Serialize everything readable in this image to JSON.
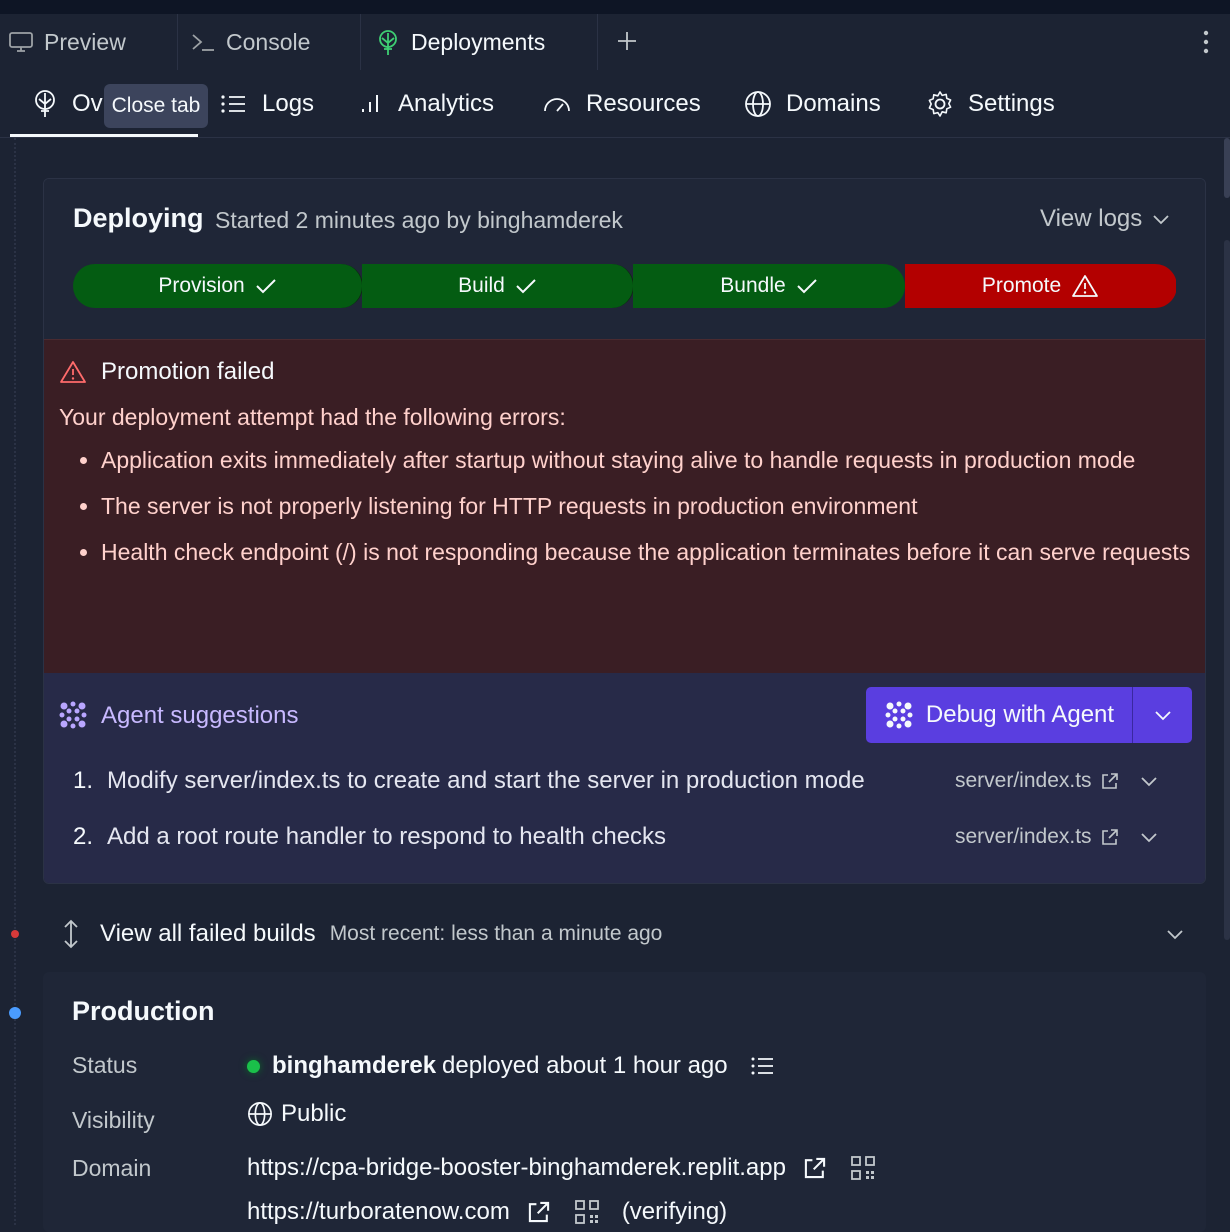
{
  "tabs": [
    {
      "label": "Preview",
      "icon": "monitor-icon"
    },
    {
      "label": "Console",
      "icon": "terminal-icon"
    },
    {
      "label": "Deployments",
      "icon": "deployments-icon",
      "active": true
    }
  ],
  "tooltip": "Close tab",
  "subnav": {
    "overview_visible": "Ov",
    "logs": "Logs",
    "analytics": "Analytics",
    "resources": "Resources",
    "domains": "Domains",
    "settings": "Settings"
  },
  "deploy": {
    "status": "Deploying",
    "started": "Started 2 minutes ago by binghamderek",
    "view_logs": "View logs",
    "steps": [
      {
        "label": "Provision",
        "state": "done"
      },
      {
        "label": "Build",
        "state": "done"
      },
      {
        "label": "Bundle",
        "state": "done"
      },
      {
        "label": "Promote",
        "state": "failed"
      }
    ]
  },
  "error": {
    "title": "Promotion failed",
    "intro": "Your deployment attempt had the following errors:",
    "items": [
      "Application exits immediately after startup without staying alive to handle requests in production mode",
      "The server is not properly listening for HTTP requests in production environment",
      "Health check endpoint (/) is not responding because the application terminates before it can serve requests"
    ]
  },
  "agent": {
    "title": "Agent suggestions",
    "debug_button": "Debug with Agent",
    "suggestions": [
      {
        "num": "1.",
        "text": "Modify server/index.ts to create and start the server in production mode",
        "file": "server/index.ts"
      },
      {
        "num": "2.",
        "text": "Add a root route handler to respond to health checks",
        "file": "server/index.ts"
      }
    ]
  },
  "failed_builds": {
    "label": "View all failed builds",
    "recent": "Most recent: less than a minute ago"
  },
  "production": {
    "title": "Production",
    "status_label": "Status",
    "status_user": "binghamderek",
    "status_text": "deployed about 1 hour ago",
    "visibility_label": "Visibility",
    "visibility_value": "Public",
    "domain_label": "Domain",
    "domain_1": "https://cpa-bridge-booster-binghamderek.replit.app",
    "domain_2": "https://turboratenow.com",
    "domain_2_status": "(verifying)"
  },
  "colors": {
    "success": "#045c12",
    "failure": "#b30000",
    "agent": "#5a3ee0"
  }
}
